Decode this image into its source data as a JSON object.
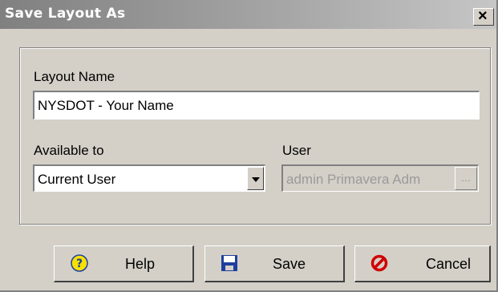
{
  "window": {
    "title": "Save Layout As",
    "close_glyph": "×"
  },
  "form": {
    "layout_name_label": "Layout Name",
    "layout_name_value": "NYSDOT - Your Name",
    "available_to_label": "Available to",
    "available_to_value": "Current User",
    "user_label": "User",
    "user_value": "admin Primavera Adm",
    "user_browse_label": "..."
  },
  "buttons": {
    "help": {
      "label": "Help",
      "icon": "help-icon"
    },
    "save": {
      "label": "Save",
      "icon": "floppy-disk-icon"
    },
    "cancel": {
      "label": "Cancel",
      "icon": "cancel-icon"
    }
  },
  "colors": {
    "face": "#d4d0c8",
    "title_gradient_start": "#808080",
    "help_icon": "#f7e100",
    "save_icon": "#1e3f9e",
    "cancel_icon": "#d00000"
  }
}
